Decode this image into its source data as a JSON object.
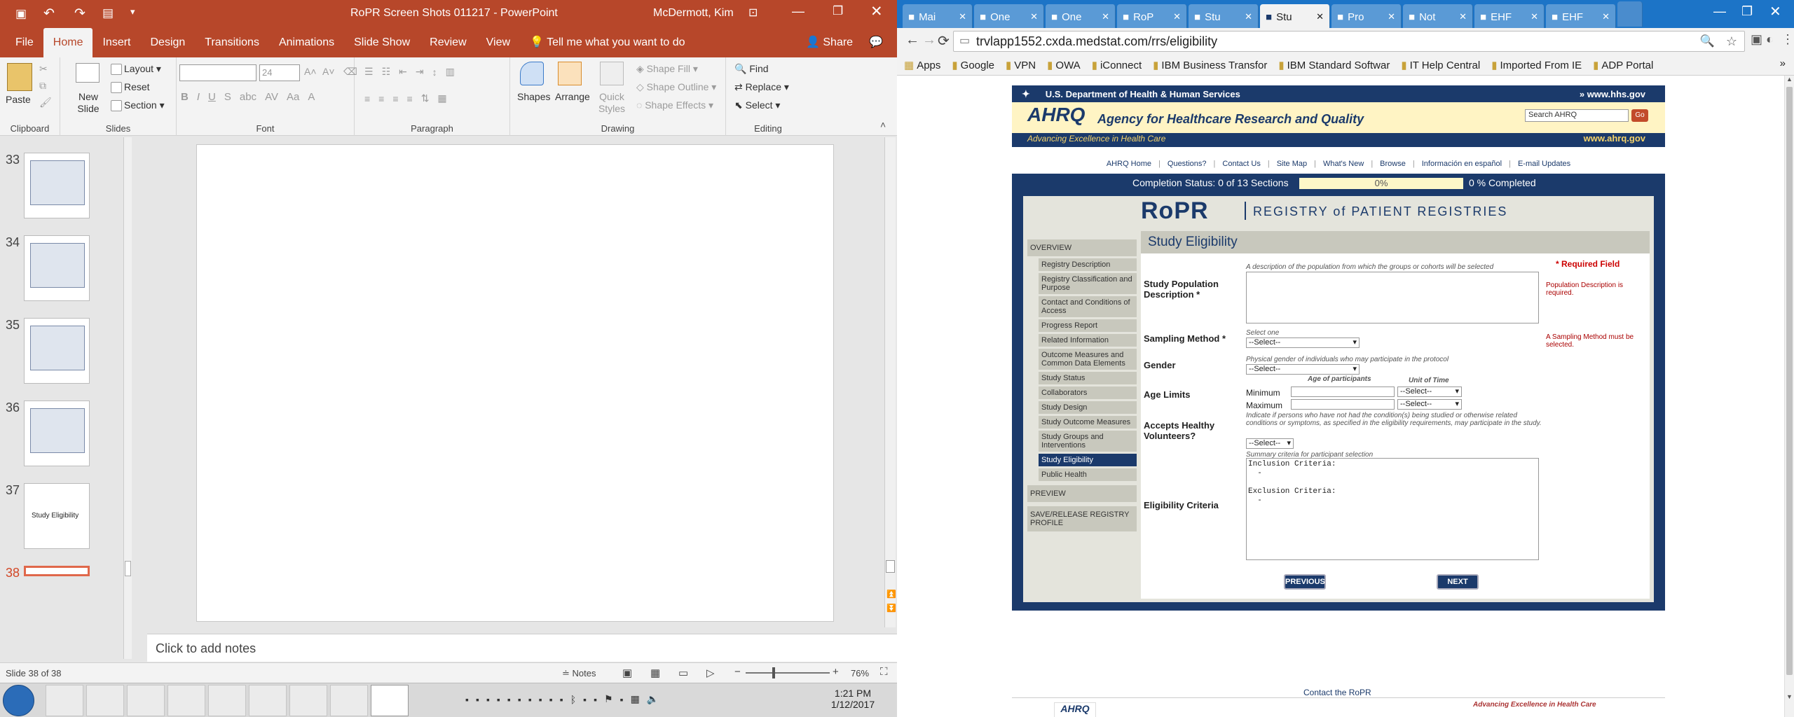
{
  "ppt": {
    "title": "RoPR Screen Shots 011217  -  PowerPoint",
    "user": "McDermott, Kim",
    "tabs": [
      "File",
      "Home",
      "Insert",
      "Design",
      "Transitions",
      "Animations",
      "Slide Show",
      "Review",
      "View"
    ],
    "tell_me": "Tell me what you want to do",
    "share": "Share",
    "ribbon": {
      "clipboard": {
        "paste": "Paste",
        "label": "Clipboard"
      },
      "slides": {
        "new_slide": "New Slide",
        "layout": "Layout",
        "reset": "Reset",
        "section": "Section",
        "label": "Slides"
      },
      "font": {
        "size": "24",
        "label": "Font"
      },
      "paragraph": {
        "label": "Paragraph"
      },
      "drawing": {
        "shapes": "Shapes",
        "arrange": "Arrange",
        "quick_styles": "Quick Styles",
        "fill": "Shape Fill",
        "outline": "Shape Outline",
        "effects": "Shape Effects",
        "label": "Drawing"
      },
      "editing": {
        "find": "Find",
        "replace": "Replace",
        "select": "Select",
        "label": "Editing"
      }
    },
    "thumbs": [
      {
        "num": "33",
        "text": ""
      },
      {
        "num": "34",
        "text": ""
      },
      {
        "num": "35",
        "text": ""
      },
      {
        "num": "36",
        "text": ""
      },
      {
        "num": "37",
        "text": "Study Eligibility"
      },
      {
        "num": "38",
        "text": ""
      }
    ],
    "notes_placeholder": "Click to add notes",
    "status": {
      "slide": "Slide 38 of 38",
      "notes": "Notes",
      "zoom": "76%"
    }
  },
  "chrome": {
    "tabs": [
      "Mai",
      "One",
      "One",
      "RoP",
      "Stu",
      "Stu",
      "Pro",
      "Not",
      "EHF",
      "EHF"
    ],
    "url": "trvlapp1552.cxda.medstat.com/rrs/eligibility",
    "bookmarks": [
      "Apps",
      "Google",
      "VPN",
      "OWA",
      "iConnect",
      "IBM Business Transfor",
      "IBM Standard Softwar",
      "IT Help Central",
      "Imported From IE",
      "ADP Portal"
    ]
  },
  "page": {
    "hhs_left": "U.S. Department of Health & Human Services",
    "hhs_right": "www.hhs.gov",
    "ahrq_logo": "AHRQ",
    "ahrq_name": "Agency for Healthcare Research and Quality",
    "ahrq_tag": "Advancing Excellence in Health Care",
    "ahrq_url": "www.ahrq.gov",
    "search_placeholder": "Search AHRQ",
    "go": "Go",
    "nav": [
      "AHRQ Home",
      "Questions?",
      "Contact Us",
      "Site Map",
      "What's New",
      "Browse",
      "Información en español",
      "E-mail Updates"
    ],
    "completion_label": "Completion Status: 0 of 13 Sections",
    "completion_pct": "0%",
    "completion_text": "0 % Completed",
    "completion_value": 0,
    "ropr_logo": "RoPR",
    "registry_title": "REGISTRY of PATIENT REGISTRIES",
    "sidebar": [
      {
        "label": "OVERVIEW",
        "sub": false,
        "active": false
      },
      {
        "label": "Registry Description",
        "sub": true,
        "active": false
      },
      {
        "label": "Registry Classification and Purpose",
        "sub": true,
        "active": false
      },
      {
        "label": "Contact and Conditions of Access",
        "sub": true,
        "active": false
      },
      {
        "label": "Progress Report",
        "sub": true,
        "active": false
      },
      {
        "label": "Related Information",
        "sub": true,
        "active": false
      },
      {
        "label": "Outcome Measures and Common Data Elements",
        "sub": true,
        "active": false
      },
      {
        "label": "Study Status",
        "sub": true,
        "active": false
      },
      {
        "label": "Collaborators",
        "sub": true,
        "active": false
      },
      {
        "label": "Study Design",
        "sub": true,
        "active": false
      },
      {
        "label": "Study Outcome Measures",
        "sub": true,
        "active": false
      },
      {
        "label": "Study Groups and Interventions",
        "sub": true,
        "active": false
      },
      {
        "label": "Study Eligibility",
        "sub": true,
        "active": true
      },
      {
        "label": "Public Health",
        "sub": true,
        "active": false
      },
      {
        "label": "PREVIEW",
        "sub": false,
        "active": false
      },
      {
        "label": "SAVE/RELEASE REGISTRY PROFILE",
        "sub": false,
        "active": false
      }
    ],
    "form_title": "Study Eligibility",
    "required_note": "* Required Field",
    "pop_label": "Study Population Description *",
    "pop_hint": "A description of the population from which the groups or cohorts will be selected",
    "pop_error": "Population Description is required.",
    "sampling_label": "Sampling Method *",
    "sampling_hint": "Select one",
    "sampling_value": "--Select--",
    "sampling_error": "A Sampling Method must be selected.",
    "gender_label": "Gender",
    "gender_hint": "Physical gender of individuals who may participate in the protocol",
    "gender_value": "--Select--",
    "age_label": "Age Limits",
    "age_col1": "Age of participants",
    "age_col2": "Unit of Time",
    "age_min": "Minimum",
    "age_max": "Maximum",
    "age_unit": "--Select--",
    "healthy_label": "Accepts Healthy Volunteers?",
    "healthy_hint": "Indicate if persons who have not had the condition(s) being studied or otherwise related conditions or symptoms, as specified in the eligibility requirements, may participate in the study.",
    "healthy_value": "--Select--",
    "criteria_label": "Eligibility Criteria",
    "criteria_hint": "Summary criteria for participant selection",
    "criteria_text": "Inclusion Criteria:\n  -\n\nExclusion Criteria:\n  -",
    "prev": "PREVIOUS",
    "next": "NEXT",
    "contact": "Contact the RoPR",
    "footer_tag": "Advancing Excellence in Health Care"
  },
  "taskbar": {
    "time": "1:21 PM",
    "date": "1/12/2017"
  }
}
